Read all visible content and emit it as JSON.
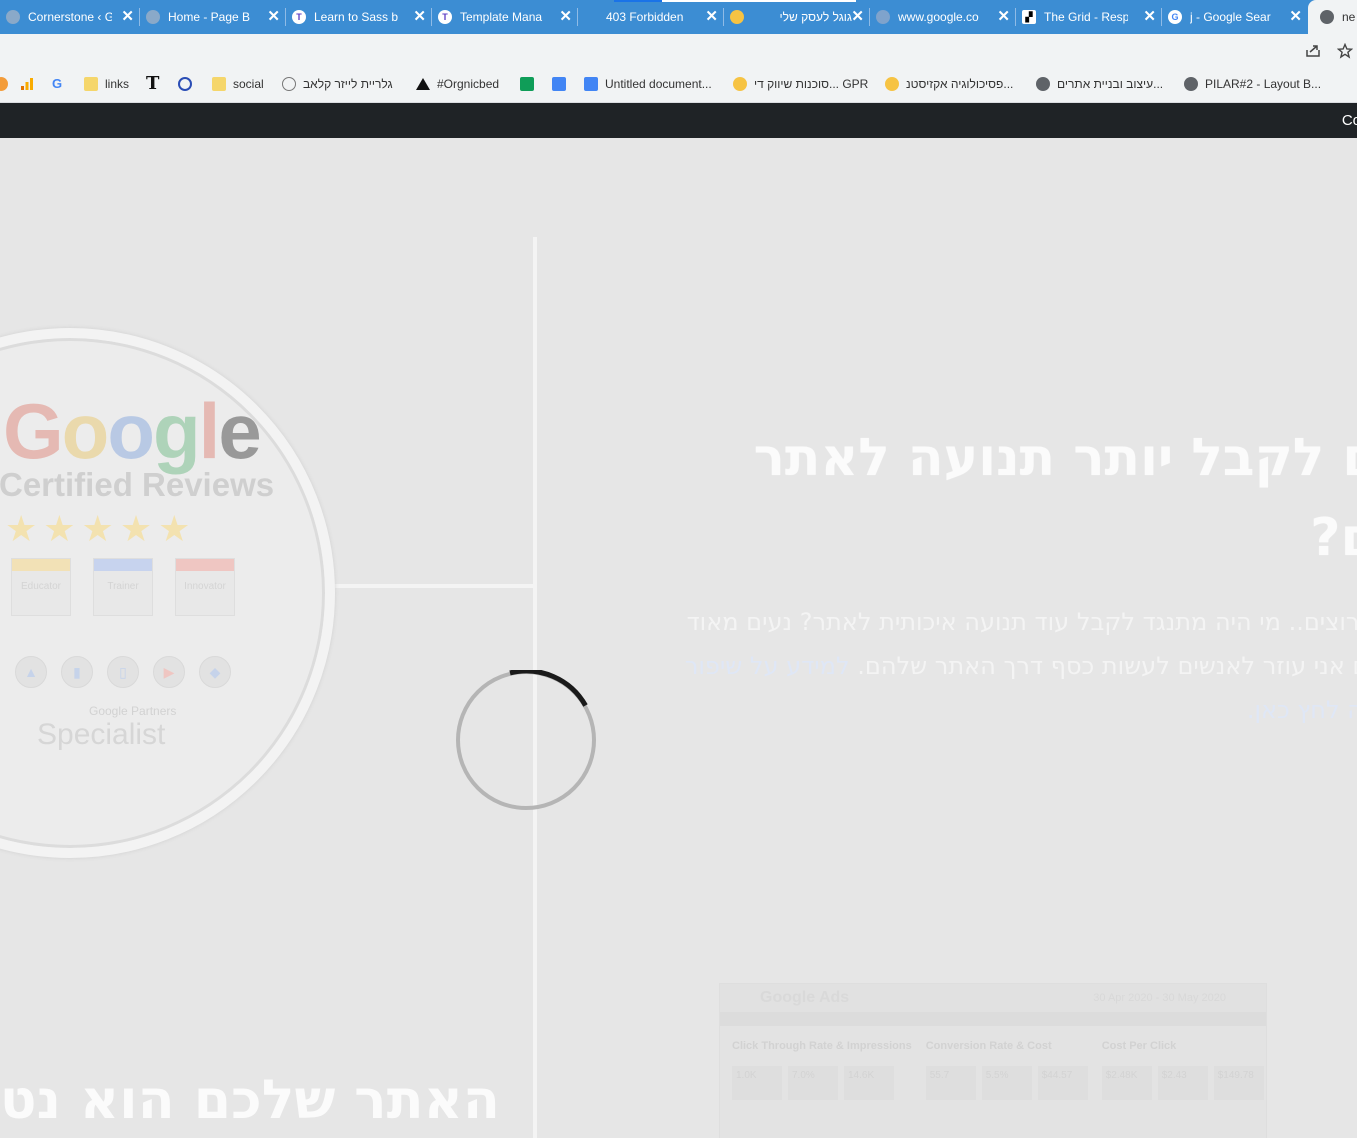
{
  "tabs": [
    {
      "title": "Cornerstone ‹ G",
      "icon": "globe-icon"
    },
    {
      "title": "Home - Page B",
      "icon": "globe-icon"
    },
    {
      "title": "Learn to Sass b",
      "icon": "t-logo-icon"
    },
    {
      "title": "Template Mana",
      "icon": "t-logo-icon"
    },
    {
      "title": "403 Forbidden",
      "icon": "blank-icon"
    },
    {
      "title": "גוגל לעסק שלי",
      "icon": "gmb-icon"
    },
    {
      "title": "www.google.co",
      "icon": "loading-icon"
    },
    {
      "title": "The Grid - Resp",
      "icon": "grid-icon"
    },
    {
      "title": "j - Google Sear",
      "icon": "google-icon"
    },
    {
      "title": "ne",
      "icon": "globe-icon"
    }
  ],
  "toolbar": {
    "zoom_icon": "zoom-icon",
    "share_icon": "share-icon",
    "star_icon": "star-icon"
  },
  "bookmarks": [
    {
      "label": "",
      "icon": "analytics-icon"
    },
    {
      "label": "",
      "icon": "google-icon"
    },
    {
      "label": "links",
      "icon": "folder-icon"
    },
    {
      "label": "",
      "icon": "t-serif-icon"
    },
    {
      "label": "",
      "icon": "swirl-icon"
    },
    {
      "label": "social",
      "icon": "folder-icon"
    },
    {
      "label": "גלריית לייזר קלאב",
      "icon": "globe-icon"
    },
    {
      "label": "#Orgnicbed",
      "icon": "triangle-icon"
    },
    {
      "label": "",
      "icon": "sheets-icon"
    },
    {
      "label": "",
      "icon": "docs-icon"
    },
    {
      "label": "Untitled document...",
      "icon": "docs-icon"
    },
    {
      "label": "סוכנות שיווק די... GPR",
      "icon": "gmb-icon"
    },
    {
      "label": "פסיכולוגיה אקזיסטנ...",
      "icon": "gmb-icon"
    },
    {
      "label": "עיצוב ובניית אתרים...",
      "icon": "globe-icon"
    },
    {
      "label": "PILAR#2 - Layout B...",
      "icon": "globe-icon"
    }
  ],
  "site": {
    "topbar_text": "Co",
    "heading": "רוצים לקבל יותר תנועה לאתר שלכם?",
    "paragraph": "ברור שאתם רוצים.. מי היה מתנגד לקבל עוד תנועה איכותית לאתר? נעים מאוד שמי גיל רותם אני עוזר לאנשים לעשות כסף דרך האתר שלהם.",
    "paragraph_link": "למידע על שיפור תהליכי מכירה לחץ כאן.",
    "bottom_heading": "האתר שלכם הוא נטל",
    "badge": {
      "google": [
        "G",
        "o",
        "o",
        "g",
        "l",
        "e"
      ],
      "reviews": "Certified Reviews",
      "stars": "★★★★★",
      "cards": [
        "Educator",
        "Trainer",
        "Innovator"
      ],
      "partners": "Google Partners",
      "specialist": "Specialist"
    },
    "ads_panel": {
      "logo": "Google Ads",
      "date": "30 Apr 2020 - 30 May 2020",
      "columns": [
        {
          "title": "Click Through Rate & Impressions",
          "values": [
            "1.0K",
            "7.0%",
            "14.6K"
          ]
        },
        {
          "title": "Conversion Rate & Cost",
          "values": [
            "55.7",
            "5.5%",
            "$44.57"
          ]
        },
        {
          "title": "Cost Per Click",
          "values": [
            "$2.48K",
            "$2.43",
            "$149.78"
          ]
        }
      ]
    }
  },
  "colors": {
    "tabstrip": "#3c8dd3",
    "toolbar": "#f1f3f4",
    "sitebar": "#1f2326",
    "overlay": "#e6e6e6",
    "spinner": "#1a1a1a"
  }
}
